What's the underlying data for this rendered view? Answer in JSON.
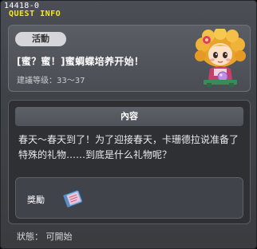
{
  "window": {
    "quest_id": "14418-0",
    "title": "QUEST INFO"
  },
  "summary": {
    "tag": "活動",
    "quest_name": "[蜜？蜜！]蜜蜩蝶培养开始！",
    "level_requirement": "建議等级：33～37",
    "npc_icon": "npc-girl-portrait-icon"
  },
  "content": {
    "header": "內容",
    "text": "春天～春天到了！为了迎接春天，卡珊德拉说准备了特殊的礼物……到底是什么礼物呢？",
    "reward": {
      "label": "獎勵",
      "icon": "book-item-icon"
    }
  },
  "status": "狀態： 可開始",
  "colors": {
    "title_yellow": "#f4e81c",
    "panel_dark": "#2e3034",
    "window_gray": "#3f4247"
  }
}
